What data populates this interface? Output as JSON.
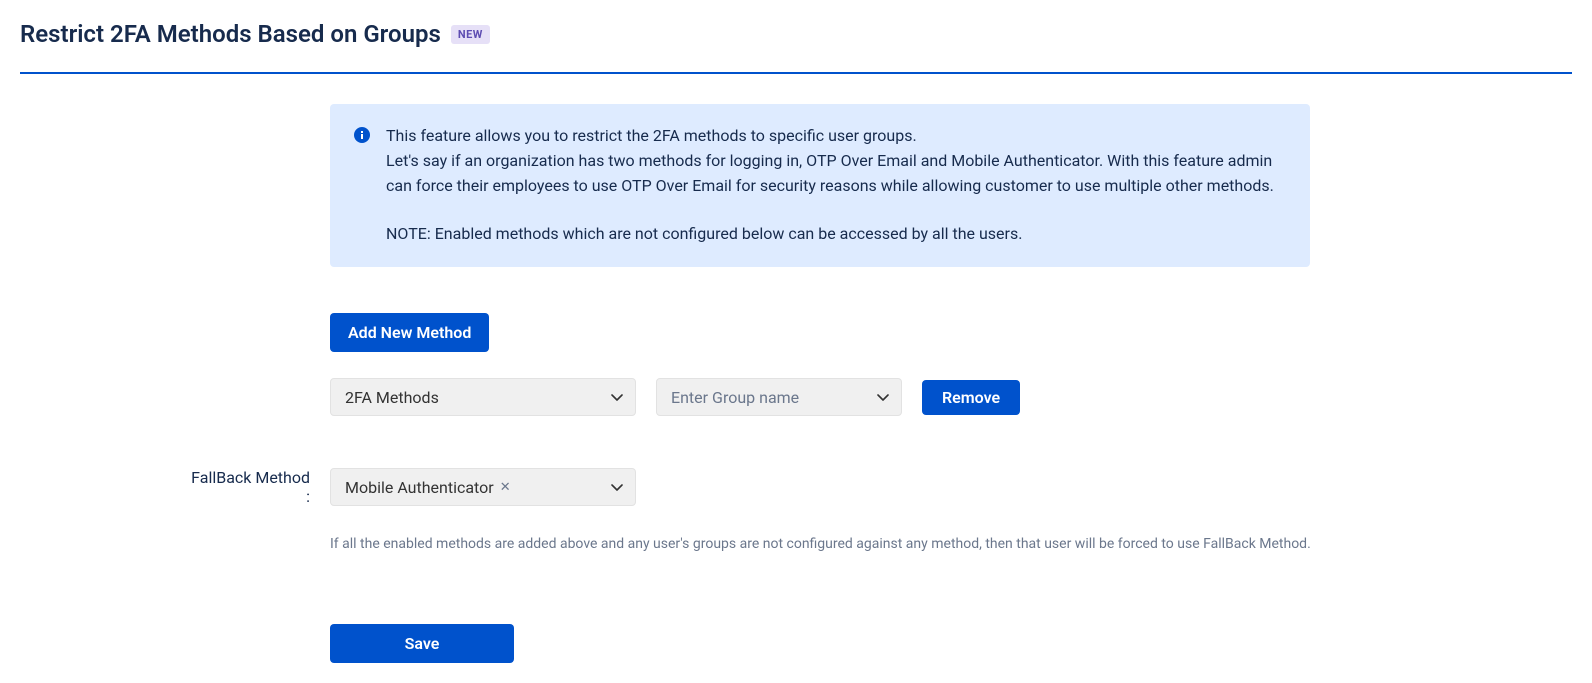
{
  "header": {
    "title": "Restrict 2FA Methods Based on Groups",
    "badge": "NEW"
  },
  "info": {
    "line1": "This feature allows you to restrict the 2FA methods to specific user groups.",
    "line2": "Let's say if an organization has two methods for logging in, OTP Over Email and Mobile Authenticator. With this feature admin can force their employees to use OTP Over Email for security reasons while allowing customer to use multiple other methods.",
    "note": "NOTE: Enabled methods which are not configured below can be accessed by all the users."
  },
  "buttons": {
    "add_new_method": "Add New Method",
    "remove": "Remove",
    "save": "Save"
  },
  "method_row": {
    "method_select_label": "2FA Methods",
    "group_placeholder": "Enter Group name"
  },
  "fallback": {
    "label": "FallBack Method :",
    "selected": "Mobile Authenticator",
    "helper": "If all the enabled methods are added above and any user's groups are not configured against any method, then that user will be forced to use FallBack Method."
  }
}
